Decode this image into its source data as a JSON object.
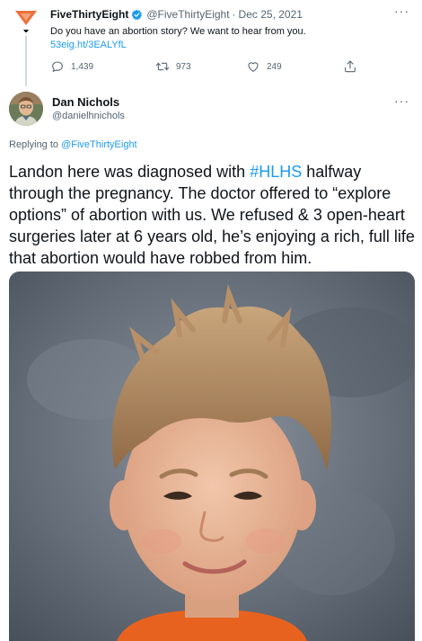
{
  "parent": {
    "name": "FiveThirtyEight",
    "handle": "@FiveThirtyEight",
    "separator": "·",
    "date": "Dec 25, 2021",
    "text": "Do you have an abortion story? We want to hear from you.",
    "link": "53eig.ht/3EALYfL",
    "more": "···",
    "replies": "1,439",
    "retweets": "973",
    "likes": "249",
    "logo_color": "#ed713a"
  },
  "tweet": {
    "name": "Dan Nichols",
    "handle": "@danielhnichols",
    "more": "···",
    "replying_prefix": "Replying to ",
    "replying_to": "@FiveThirtyEight",
    "text_1": "Landon here was diagnosed with ",
    "hashtag": "#HLHS",
    "text_2": " halfway through the pregnancy. The doctor offered to “explore options” of abortion with us. We refused & 3 open-heart surgeries later at 6 years old, he’s enjoying a rich, full life that abortion would have robbed from him."
  },
  "colors": {
    "link": "#1d9bf0",
    "secondary_text": "#536471",
    "primary_text": "#0f1419"
  }
}
